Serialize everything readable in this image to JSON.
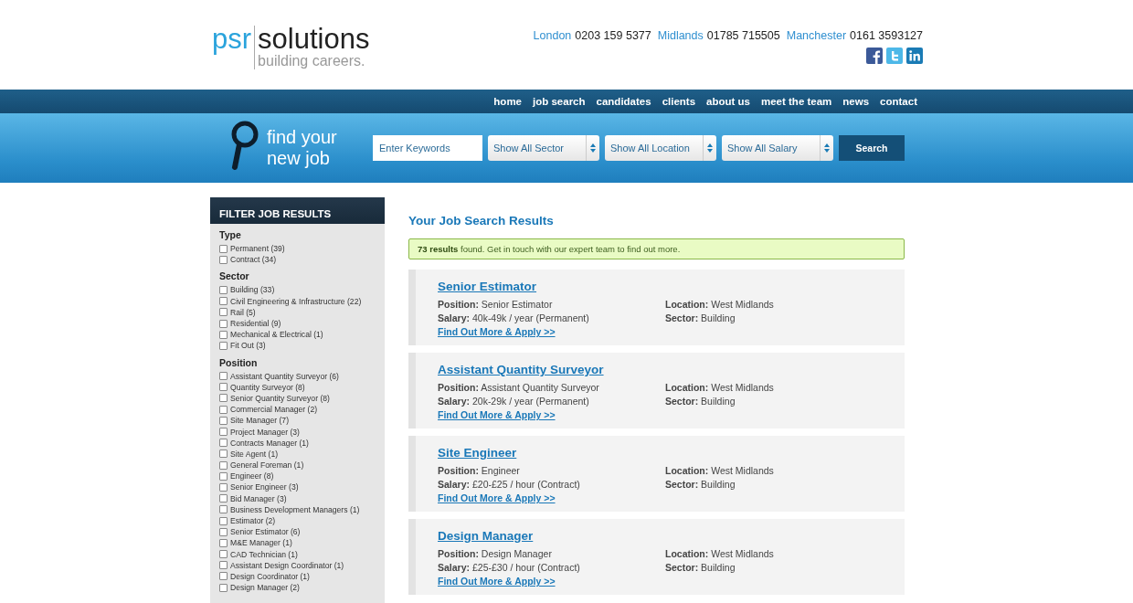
{
  "header": {
    "logo": {
      "brand_left": "psr",
      "brand_right": "solutions",
      "tagline": "building careers."
    },
    "phones": [
      {
        "city": "London",
        "number": "0203 159 5377"
      },
      {
        "city": "Midlands",
        "number": "01785 715505"
      },
      {
        "city": "Manchester",
        "number": "0161 3593127"
      }
    ],
    "social": [
      {
        "kind": "facebook"
      },
      {
        "kind": "twitter"
      },
      {
        "kind": "linkedin"
      }
    ]
  },
  "nav": [
    {
      "label": "home"
    },
    {
      "label": "job search"
    },
    {
      "label": "candidates"
    },
    {
      "label": "clients"
    },
    {
      "label": "about us"
    },
    {
      "label": "meet the team"
    },
    {
      "label": "news"
    },
    {
      "label": "contact"
    }
  ],
  "search": {
    "heading_line1": "find your",
    "heading_line2": "new job",
    "keywords": {
      "placeholder": "Enter Keywords"
    },
    "selects": [
      {
        "value": "Show All Sector"
      },
      {
        "value": "Show All Location"
      },
      {
        "value": "Show All Salary"
      }
    ],
    "button": "Search"
  },
  "sidebar": {
    "title": "FILTER JOB RESULTS",
    "groups": [
      {
        "heading": "Type",
        "options": [
          {
            "label": "Permanent (39)",
            "checked": false
          },
          {
            "label": "Contract (34)",
            "checked": false
          }
        ]
      },
      {
        "heading": "Sector",
        "options": [
          {
            "label": "Building (33)",
            "checked": false
          },
          {
            "label": "Civil Engineering & Infrastructure (22)",
            "checked": false
          },
          {
            "label": "Rail (5)",
            "checked": false
          },
          {
            "label": "Residential (9)",
            "checked": false
          },
          {
            "label": "Mechanical & Electrical (1)",
            "checked": false
          },
          {
            "label": "Fit Out (3)",
            "checked": false
          }
        ]
      },
      {
        "heading": "Position",
        "options": [
          {
            "label": "Assistant Quantity Surveyor (6)",
            "checked": false
          },
          {
            "label": "Quantity Surveyor (8)",
            "checked": false
          },
          {
            "label": "Senior Quantity Surveyor (8)",
            "checked": false
          },
          {
            "label": "Commercial Manager (2)",
            "checked": false
          },
          {
            "label": "Site Manager (7)",
            "checked": false
          },
          {
            "label": "Project Manager (3)",
            "checked": false
          },
          {
            "label": "Contracts Manager (1)",
            "checked": false
          },
          {
            "label": "Site Agent (1)",
            "checked": false
          },
          {
            "label": "General Foreman (1)",
            "checked": false
          },
          {
            "label": "Engineer (8)",
            "checked": false
          },
          {
            "label": "Senior Engineer (3)",
            "checked": false
          },
          {
            "label": "Bid Manager (3)",
            "checked": false
          },
          {
            "label": "Business Development Managers (1)",
            "checked": false
          },
          {
            "label": "Estimator (2)",
            "checked": false
          },
          {
            "label": "Senior Estimator (6)",
            "checked": false
          },
          {
            "label": "M&E Manager (1)",
            "checked": false
          },
          {
            "label": "CAD Technician (1)",
            "checked": false
          },
          {
            "label": "Assistant Design Coordinator (1)",
            "checked": false
          },
          {
            "label": "Design Coordinator (1)",
            "checked": false
          },
          {
            "label": "Design Manager (2)",
            "checked": false
          }
        ]
      }
    ]
  },
  "results": {
    "title": "Your Job Search Results",
    "summary": "**73 results** found. Get in touch with our expert team to find out more.",
    "jobs": [
      {
        "title": "Senior Estimator",
        "position": "**Position:** Senior Estimator",
        "salary": "**Salary:** 40k-49k / year (Permanent)",
        "location": "**Location:** West Midlands",
        "sector": "**Sector:** Building",
        "link": "Find Out More & Apply >>"
      },
      {
        "title": "Assistant Quantity Surveyor",
        "position": "**Position:** Assistant Quantity Surveyor",
        "salary": "**Salary:** 20k-29k / year (Permanent)",
        "location": "**Location:** West Midlands",
        "sector": "**Sector:** Building",
        "link": "Find Out More & Apply >>"
      },
      {
        "title": "Site Engineer",
        "position": "**Position:** Engineer",
        "salary": "**Salary:** £20-£25 / hour (Contract)",
        "location": "**Location:** West Midlands",
        "sector": "**Sector:** Building",
        "link": "Find Out More & Apply >>"
      },
      {
        "title": "Design Manager",
        "position": "**Position:** Design Manager",
        "salary": "**Salary:** £25-£30 / hour (Contract)",
        "location": "**Location:** West Midlands",
        "sector": "**Sector:** Building",
        "link": "Find Out More & Apply >>"
      }
    ]
  }
}
